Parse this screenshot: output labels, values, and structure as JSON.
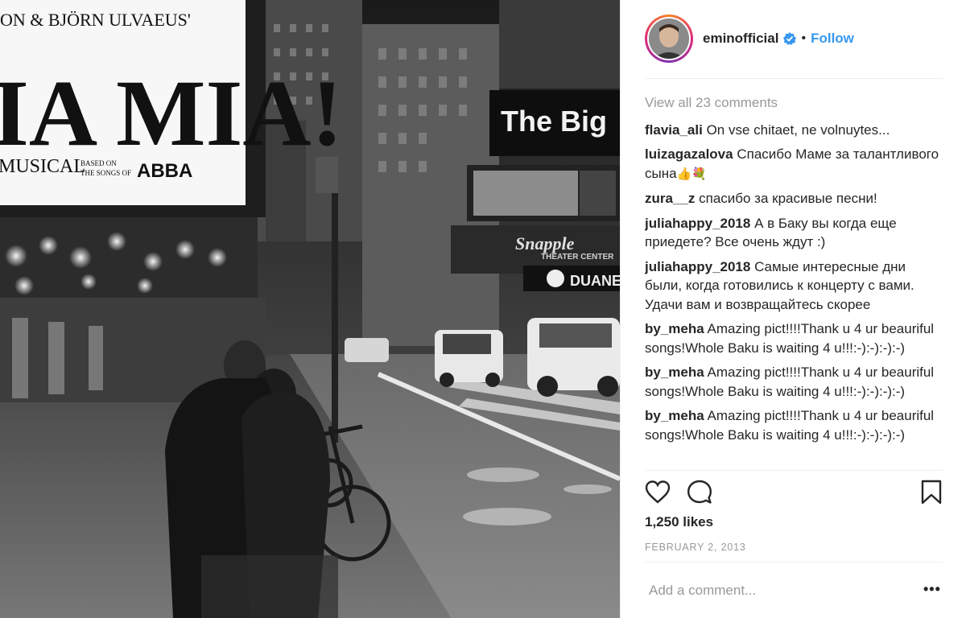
{
  "post": {
    "username": "eminofficial",
    "follow_label": "Follow",
    "separator": "•",
    "view_all_comments": "View all 23 comments",
    "likes": "1,250 likes",
    "date": "FEBRUARY 2, 2013",
    "add_comment_placeholder": "Add a comment...",
    "more_label": "•••",
    "accent_color": "#3897f0",
    "verified_color": "#3897f0"
  },
  "photo": {
    "marquee_top": "ON & BJÖRN ULVAEUS'",
    "marquee_title": "IA MIA!",
    "marquee_musical": "MUSICAL",
    "marquee_based1": "BASED ON",
    "marquee_based2": "THE SONGS OF",
    "marquee_abba": "ABBA",
    "billboard": "The Big",
    "snapple": "Snapple",
    "theater_center": "THEATER CENTER",
    "duane": "DUANE"
  },
  "comments": [
    {
      "user": "flavia_ali",
      "text": "On vse chitaet, ne volnuytes..."
    },
    {
      "user": "luizagazalova",
      "text": "Спасибо Маме за талантливого сына",
      "emoji": "👍💐"
    },
    {
      "user": "zura__z",
      "text": "спасибо за красивые песни!"
    },
    {
      "user": "juliahappy_2018",
      "text": "А в Баку вы когда еще приедете? Все очень ждут :)"
    },
    {
      "user": "juliahappy_2018",
      "text": "Самые интересные дни были, когда готовились к концерту с вами. Удачи вам и возвращайтесь скорее"
    },
    {
      "user": "by_meha",
      "text": "Amazing pict!!!!Thank u 4 ur beauriful songs!Whole Baku is waiting 4 u!!!:-):-):-):-)"
    },
    {
      "user": "by_meha",
      "text": "Amazing pict!!!!Thank u 4 ur beauriful songs!Whole Baku is waiting 4 u!!!:-):-):-):-)"
    },
    {
      "user": "by_meha",
      "text": "Amazing pict!!!!Thank u 4 ur beauriful songs!Whole Baku is waiting 4 u!!!:-):-):-):-)"
    }
  ],
  "icons": {
    "like": "heart-icon",
    "comment": "comment-bubble-icon",
    "save": "bookmark-icon",
    "verified": "verified-badge-icon"
  }
}
